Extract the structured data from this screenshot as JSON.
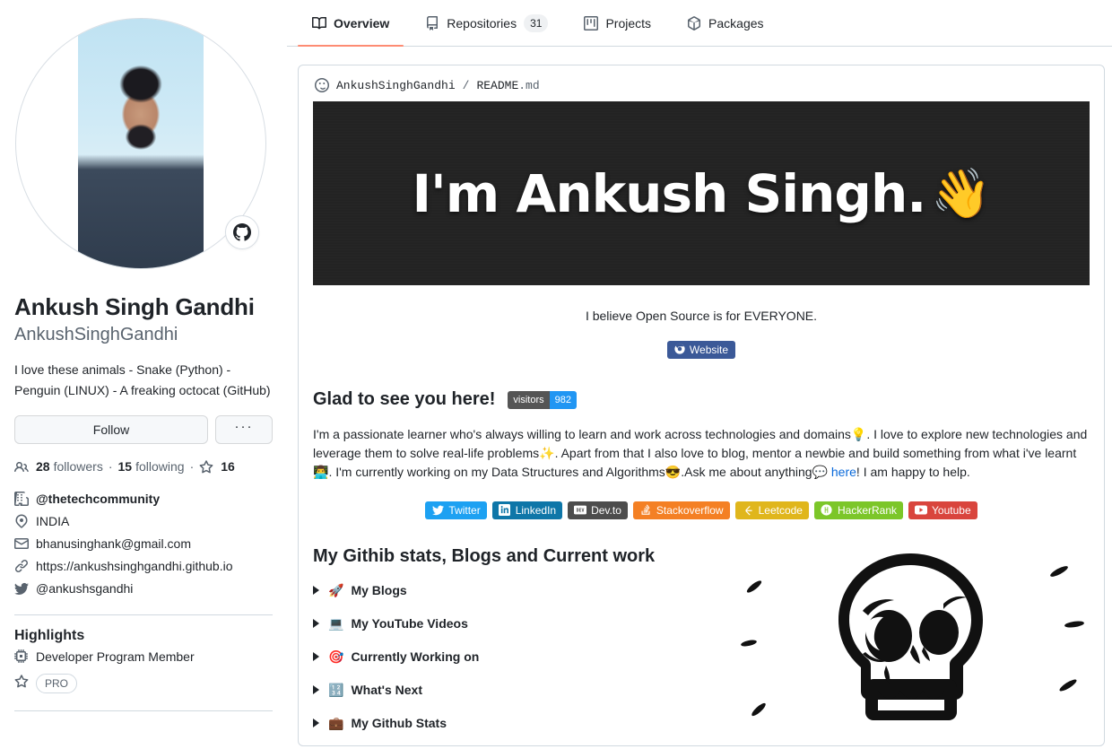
{
  "tabs": [
    {
      "label": "Overview",
      "icon": "book-icon",
      "count": null,
      "active": true
    },
    {
      "label": "Repositories",
      "icon": "repo-icon",
      "count": "31",
      "active": false
    },
    {
      "label": "Projects",
      "icon": "project-icon",
      "count": null,
      "active": false
    },
    {
      "label": "Packages",
      "icon": "package-icon",
      "count": null,
      "active": false
    }
  ],
  "profile": {
    "name": "Ankush Singh Gandhi",
    "login": "AnkushSinghGandhi",
    "bio": "I love these animals - Snake (Python) - Penguin (LINUX) - A freaking octocat (GitHub)",
    "follow_label": "Follow",
    "more_label": "···",
    "stats": {
      "followers_count": "28",
      "followers_label": "followers",
      "following_count": "15",
      "following_label": "following",
      "stars_count": "16"
    },
    "details": [
      {
        "icon": "organization-icon",
        "text": "@thetechcommunity",
        "bold": true
      },
      {
        "icon": "location-icon",
        "text": "INDIA",
        "bold": false
      },
      {
        "icon": "mail-icon",
        "text": "bhanusinghank@gmail.com",
        "bold": false
      },
      {
        "icon": "link-icon",
        "text": "https://ankushsinghgandhi.github.io",
        "bold": false
      },
      {
        "icon": "twitter-icon",
        "text": "@ankushsgandhi",
        "bold": false
      }
    ],
    "highlights_title": "Highlights",
    "highlights": [
      {
        "icon": "cpu-icon",
        "text": "Developer Program Member",
        "pill": false
      },
      {
        "icon": "star-icon",
        "text": "PRO",
        "pill": true
      }
    ]
  },
  "readme": {
    "owner": "AnkushSinghGandhi",
    "slash": "/",
    "filename": "README",
    "extension": ".md",
    "banner_text": "I'm Ankush Singh.",
    "banner_emoji": "👋",
    "banner_bg": "#232323",
    "tagline": "I believe Open Source is for EVERYONE.",
    "website_badge": {
      "label": "Website",
      "color": "#3b5998"
    },
    "greeting_heading": "Glad to see you here!",
    "visitors_badge": {
      "label": "visitors",
      "value": "982",
      "label_color": "#555555",
      "value_color": "#2196f3"
    },
    "about_parts": [
      {
        "type": "text",
        "value": "I'm a passionate learner who's always willing to learn and work across technologies and domains"
      },
      {
        "type": "emoji",
        "value": "💡"
      },
      {
        "type": "text",
        "value": ". I love to explore new technologies and leverage them to solve real-life problems"
      },
      {
        "type": "emoji",
        "value": "✨"
      },
      {
        "type": "text",
        "value": ". Apart from that I also love to blog, mentor a newbie and build something from what i've learnt"
      },
      {
        "type": "emoji",
        "value": "👨‍💻"
      },
      {
        "type": "text",
        "value": ". I'm currently working on my Data Structures and Algorithms"
      },
      {
        "type": "emoji",
        "value": "😎"
      },
      {
        "type": "text",
        "value": ".Ask me about anything"
      },
      {
        "type": "emoji",
        "value": "💬"
      },
      {
        "type": "link",
        "value": "here"
      },
      {
        "type": "text",
        "value": "! I am happy to help."
      }
    ],
    "socials": [
      {
        "label": "Twitter",
        "color": "#1da1f2",
        "icon": "twitter-icon"
      },
      {
        "label": "LinkedIn",
        "color": "#0e76a8",
        "icon": "linkedin-icon"
      },
      {
        "label": "Dev.to",
        "color": "#4d4d4d",
        "icon": "devto-icon"
      },
      {
        "label": "Stackoverflow",
        "color": "#f48024",
        "icon": "stackoverflow-icon"
      },
      {
        "label": "Leetcode",
        "color": "#e0b61c",
        "icon": "leetcode-icon"
      },
      {
        "label": "HackerRank",
        "color": "#7cc629",
        "icon": "hackerrank-icon"
      },
      {
        "label": "Youtube",
        "color": "#d9453d",
        "icon": "youtube-icon"
      }
    ],
    "stats_heading": "My Githib stats, Blogs and Current work",
    "details_sections": [
      {
        "emoji": "🚀",
        "label": "My Blogs"
      },
      {
        "emoji": "💻",
        "label": "My YouTube Videos"
      },
      {
        "emoji": "🎯",
        "label": "Currently Working on"
      },
      {
        "emoji": "🔢",
        "label": "What's Next"
      },
      {
        "emoji": "💼",
        "label": "My Github Stats"
      }
    ],
    "side_illustration": "skull-illustration"
  }
}
